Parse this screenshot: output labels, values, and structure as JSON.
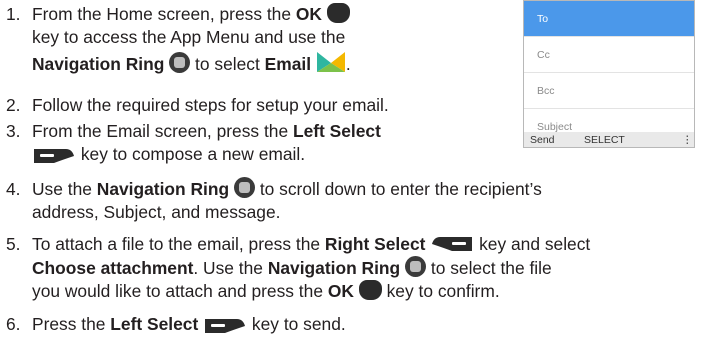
{
  "steps": [
    {
      "num": "1.",
      "l1a": "From the Home screen, press the ",
      "l1b": "OK",
      "l2": "key to access the App Menu and use the",
      "l3a": "Navigation Ring",
      "l3b": " to select ",
      "l3c": "Email",
      "l3d": "."
    },
    {
      "num": "2.",
      "text": "Follow the required steps for setup your email."
    },
    {
      "num": "3.",
      "l1a": "From the Email screen, press the ",
      "l1b": "Left Select",
      "l2": " key to compose a new email."
    },
    {
      "num": "4.",
      "l1a": "Use the ",
      "l1b": "Navigation Ring",
      "l1c": " to scroll down to enter the recipient’s",
      "l2": "address, Subject, and message."
    },
    {
      "num": "5.",
      "l1a": "To attach a file to the email, press the ",
      "l1b": "Right Select",
      "l1c": " key and select",
      "l2a": "Choose attachment",
      "l2b": ". Use the ",
      "l2c": "Navigation Ring",
      "l2d": " to select the file",
      "l3a": "you would like to attach and press the ",
      "l3b": "OK",
      "l3c": " key to confirm."
    },
    {
      "num": "6.",
      "a": "Press the ",
      "b": "Left Select",
      "c": " key to send."
    }
  ],
  "phone": {
    "fields": [
      "To",
      "Cc",
      "Bcc",
      "Subject"
    ],
    "softkeys": {
      "left": "Send",
      "center": "SELECT",
      "right": "⋮"
    },
    "accent": "#4b98ea"
  },
  "icons": [
    "ok-key-icon",
    "navigation-ring-icon",
    "email-app-icon",
    "left-select-key-icon",
    "right-select-key-icon"
  ]
}
